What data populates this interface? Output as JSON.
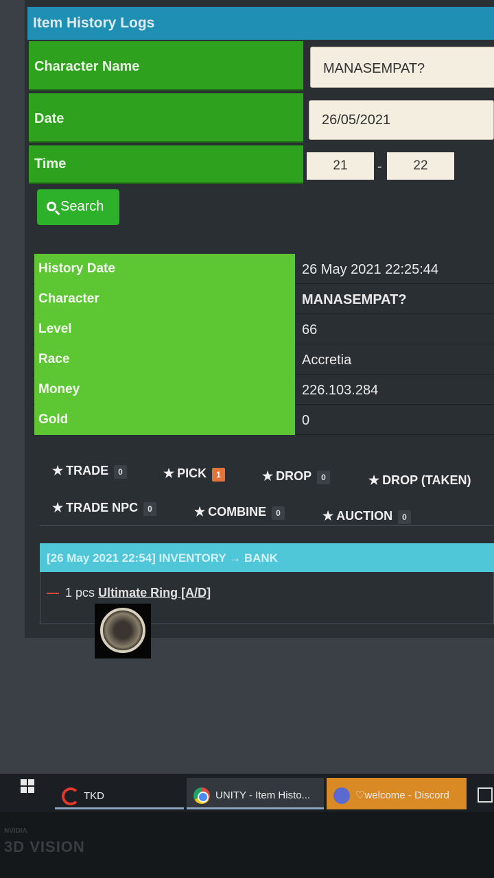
{
  "title": "Item History Logs",
  "form": {
    "character_label": "Character Name",
    "character_value": "MANASEMPAT?",
    "date_label": "Date",
    "date_value": "26/05/2021",
    "time_label": "Time",
    "time_from": "21",
    "time_separator": "-",
    "time_to": "22",
    "search_label": "Search"
  },
  "info": {
    "rows": [
      {
        "label": "History Date",
        "value": "26 May 2021 22:25:44"
      },
      {
        "label": "Character",
        "value": "MANASEMPAT?"
      },
      {
        "label": "Level",
        "value": "66"
      },
      {
        "label": "Race",
        "value": "Accretia"
      },
      {
        "label": "Money",
        "value": "226.103.284"
      },
      {
        "label": "Gold",
        "value": "0"
      }
    ]
  },
  "tabs": [
    {
      "label": "TRADE",
      "count": "0"
    },
    {
      "label": "PICK",
      "count": "1"
    },
    {
      "label": "DROP",
      "count": "0"
    },
    {
      "label": "DROP (TAKEN)",
      "count": ""
    },
    {
      "label": "TRADE NPC",
      "count": "0"
    },
    {
      "label": "COMBINE",
      "count": "0"
    },
    {
      "label": "AUCTION",
      "count": "0"
    }
  ],
  "log": {
    "header": "[26 May 2021 22:54] INVENTORY → BANK",
    "quantity": "1 pcs",
    "item_name": "Ultimate Ring [A/D]",
    "minus": "—"
  },
  "taskbar": {
    "items": [
      "TKD",
      "UNITY - Item Histo...",
      "♡welcome - Discord"
    ]
  },
  "bezel": {
    "brand": "NVIDIA",
    "label": "3D VISION"
  },
  "colors": {
    "title_bar": "#1f8fb3",
    "form_label": "#2ea21f",
    "info_label": "#5cc633",
    "log_header": "#4fc7d8",
    "search_button": "#2eb12a",
    "pick_badge": "#e2743a"
  }
}
